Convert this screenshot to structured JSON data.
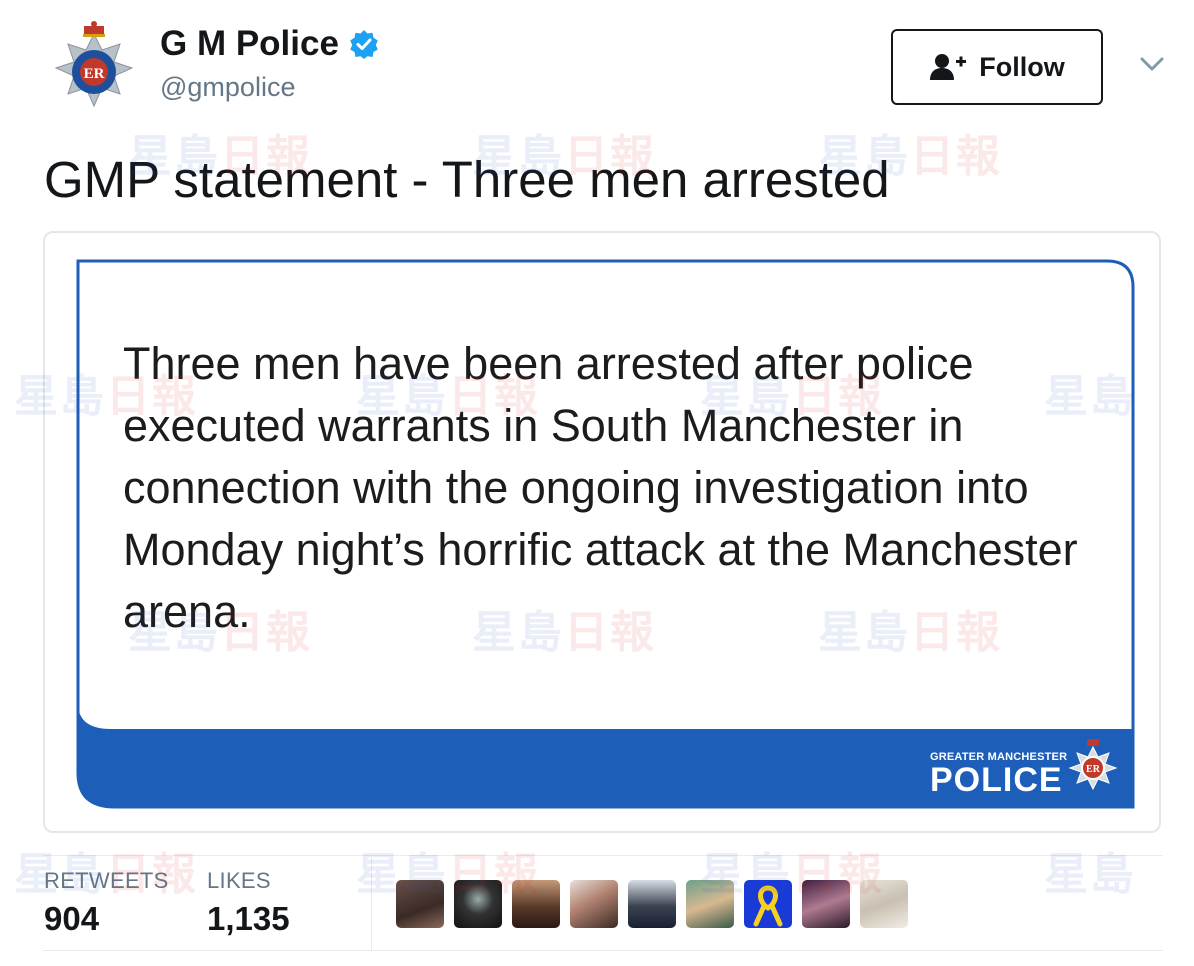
{
  "account": {
    "display_name": "G M Police",
    "handle": "@gmpolice",
    "verified": true
  },
  "actions": {
    "follow_label": "Follow"
  },
  "tweet": {
    "text": "GMP statement - Three men arrested"
  },
  "media": {
    "statement": "Three men have been arrested after police executed warrants in South Manchester in connection with the ongoing investigation into Monday night’s horrific attack at the Manchester arena.",
    "brand_small": "GREATER MANCHESTER",
    "brand_big": "POLICE",
    "badge_text": "ER"
  },
  "stats": {
    "retweets_label": "RETWEETS",
    "retweets_value": "904",
    "likes_label": "LIKES",
    "likes_value": "1,135"
  },
  "likers_count": 9,
  "watermark": {
    "part_a": "星島",
    "part_b": "日報"
  },
  "colors": {
    "accent_blue": "#1d5fb8",
    "verified_blue": "#1da1f2",
    "text_primary": "#14171a",
    "text_secondary": "#657786"
  },
  "icons": {
    "verified": "verified-badge-icon",
    "follow": "add-user-icon",
    "more": "chevron-down-icon"
  }
}
